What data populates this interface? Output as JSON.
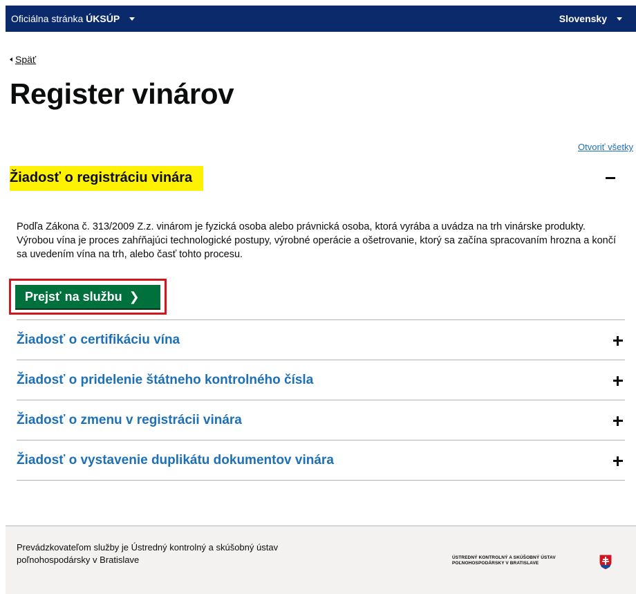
{
  "header": {
    "official_label": "Oficiálna stránka",
    "official_org": "ÚKSÚP",
    "language": "Slovensky"
  },
  "nav": {
    "back_label": "Späť"
  },
  "page": {
    "title": "Register vinárov",
    "open_all_label": "Otvoriť všetky"
  },
  "open_section": {
    "title": "Žiadosť o registráciu vinára",
    "body": "Podľa Zákona č. 313/2009 Z.z. vinárom je fyzická osoba alebo právnická osoba, ktorá vyrába a uvádza na trh vinárske produkty. Výrobou vína je proces zahŕňajúci technologické postupy, výrobné operácie a ošetrovanie, ktorý sa začína spracovaním hrozna a končí sa uvedením vína na trh, alebo časť tohto procesu.",
    "cta_label": "Prejsť na službu"
  },
  "sections": [
    {
      "title": "Žiadosť o certifikáciu vína"
    },
    {
      "title": "Žiadosť o pridelenie štátneho kontrolného čísla"
    },
    {
      "title": "Žiadosť o zmenu v registrácii vinára"
    },
    {
      "title": "Žiadosť o vystavenie duplikátu dokumentov vinára"
    }
  ],
  "footer": {
    "operator_text": "Prevádzkovateľom služby je Ústredný kontrolný a skúšobný ústav poľnohospodársky v Bratislave",
    "org_logo_text": "ÚSTREDNÝ KONTROLNÝ A SKÚŠOBNÝ ÚSTAV\nPOĽNOHOSPODÁRSKY V BRATISLAVE"
  },
  "colors": {
    "header_bg": "#0b2a6b",
    "highlight": "#fff200",
    "cta_bg": "#00703c",
    "cta_outline": "#d4151d",
    "link": "#1d70b8"
  }
}
